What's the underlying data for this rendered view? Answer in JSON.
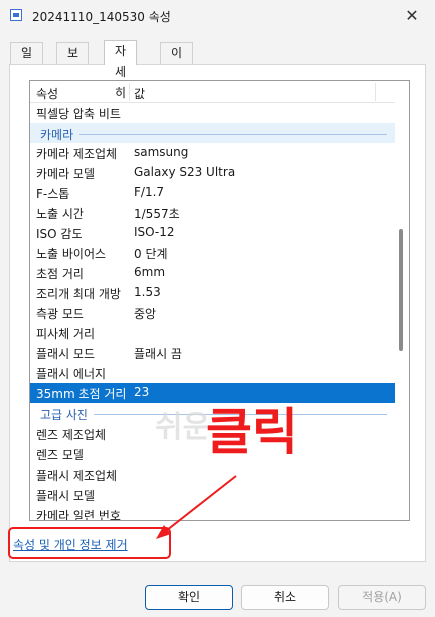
{
  "window": {
    "title": "20241110_140530 속성",
    "close": "✕"
  },
  "tabs": [
    "일반",
    "보안",
    "자세히",
    "이전 버전"
  ],
  "table": {
    "headers": {
      "property": "속성",
      "value": "값"
    }
  },
  "rows_top": [
    {
      "name": "픽셀당 압축 비트",
      "value": ""
    }
  ],
  "group_camera": "카메라",
  "rows_camera": [
    {
      "name": "카메라 제조업체",
      "value": "samsung"
    },
    {
      "name": "카메라 모델",
      "value": "Galaxy S23 Ultra"
    },
    {
      "name": "F-스톱",
      "value": "F/1.7"
    },
    {
      "name": "노출 시간",
      "value": "1/557초"
    },
    {
      "name": "ISO 감도",
      "value": "ISO-12"
    },
    {
      "name": "노출 바이어스",
      "value": "0 단계"
    },
    {
      "name": "초점 거리",
      "value": "6mm"
    },
    {
      "name": "조리개 최대 개방",
      "value": "1.53"
    },
    {
      "name": "측광 모드",
      "value": "중앙"
    },
    {
      "name": "피사체 거리",
      "value": ""
    },
    {
      "name": "플래시 모드",
      "value": "플래시 끔"
    },
    {
      "name": "플래시 에너지",
      "value": ""
    },
    {
      "name": "35mm 초점 거리",
      "value": "23"
    }
  ],
  "group_advanced": "고급 사진",
  "rows_advanced": [
    {
      "name": "렌즈 제조업체",
      "value": ""
    },
    {
      "name": "렌즈 모델",
      "value": ""
    },
    {
      "name": "플래시 제조업체",
      "value": ""
    },
    {
      "name": "플래시 모델",
      "value": ""
    },
    {
      "name": "카메라 일련 번호",
      "value": ""
    }
  ],
  "watermark": "쉬운",
  "annotation": {
    "text": "클릭",
    "color": "#ee1c1c"
  },
  "link": {
    "remove_properties": "속성 및 개인 정보 제거"
  },
  "buttons": {
    "ok": "확인",
    "cancel": "취소",
    "apply": "적용(A)"
  },
  "colors": {
    "selection": "#0b74cf",
    "link": "#1a5fb4",
    "group": "#2b62b0"
  }
}
